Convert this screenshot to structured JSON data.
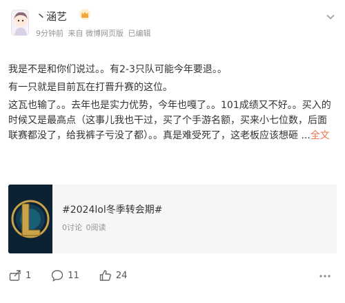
{
  "author": {
    "name": "丶涵艺",
    "badge_icon": "crown-icon"
  },
  "meta": {
    "time": "9分钟前",
    "source": "来自 微博网页版",
    "edited": "已编辑"
  },
  "post": {
    "paragraphs": [
      "我是不是和你们说过。。有2-3只队可能今年要退。。",
      "有一只就是目前瓦在打晋升赛的这位。",
      "这瓦也输了。。去年也是实力优势，今年也嘎了。。101成绩又不好。。买入的时候又是最高点（这事儿我也干过，买了个手游名额，买来小七位数，后面联赛都没了，给我裤子亏没了都）。。真是难受死了，这老板应该想砸 ..."
    ],
    "expand_label": "全文"
  },
  "topic_card": {
    "title": "#2024lol冬季转会期#",
    "discussions": "0讨论",
    "reads": "0阅读",
    "thumbnail_icon": "lol-logo-icon"
  },
  "actions": {
    "share": "1",
    "comment": "11",
    "like": "24"
  },
  "colors": {
    "link": "#eb7350",
    "meta_text": "#939393",
    "card_bg": "#f6f6f6",
    "logo_gold": "#c9a24a",
    "logo_bg": "#0c2233"
  }
}
